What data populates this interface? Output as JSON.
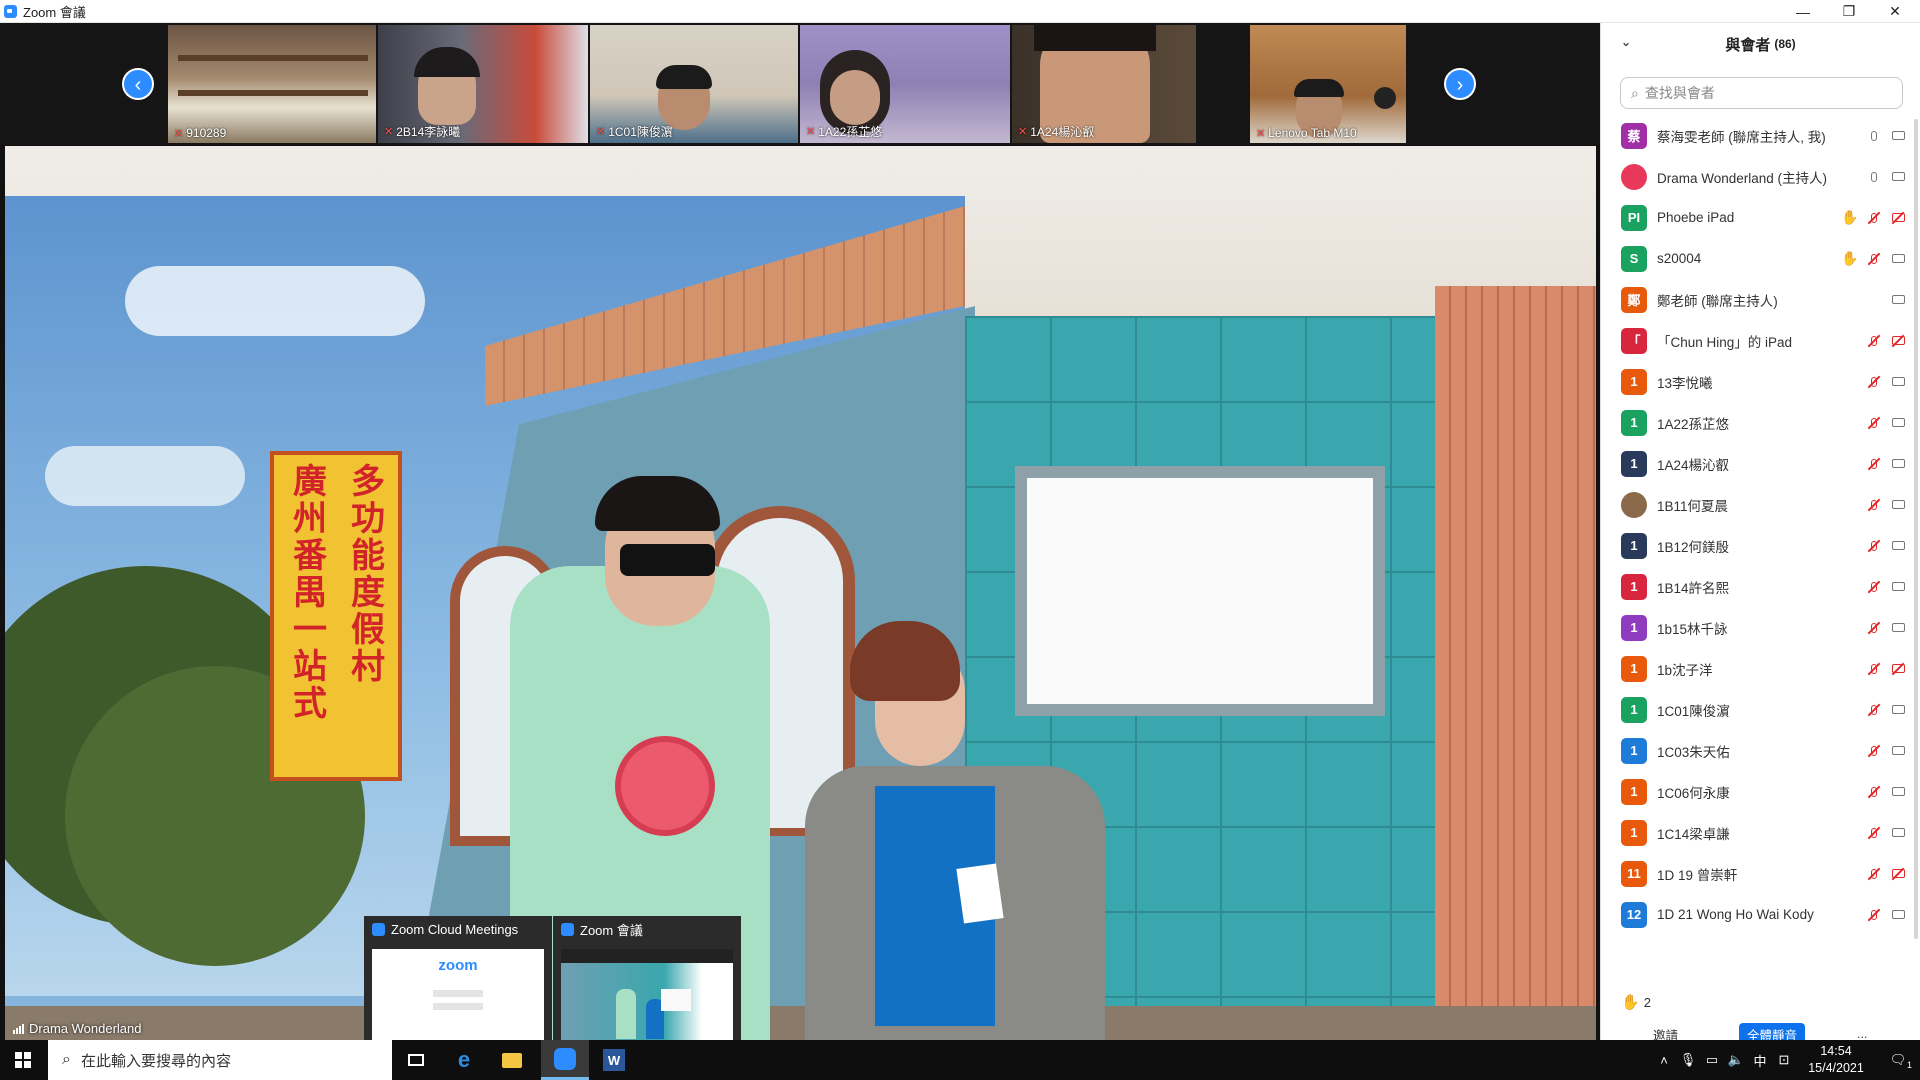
{
  "window": {
    "title": "Zoom 會議"
  },
  "thumbnails": [
    {
      "name": "910289"
    },
    {
      "name": "2B14李詠曦"
    },
    {
      "name": "1C01陳俊濵"
    },
    {
      "name": "1A22孫芷悠"
    },
    {
      "name": "1A24楊沁叡"
    },
    {
      "name": "Lenovo Tab M10"
    }
  ],
  "stage": {
    "speaker_name": "Drama Wonderland",
    "sign_left": "多功能度假村",
    "sign_right": "廣州番禺一站式"
  },
  "previews": [
    {
      "title": "Zoom Cloud Meetings",
      "logo": "zoom"
    },
    {
      "title": "Zoom 會議"
    }
  ],
  "participants_panel": {
    "title": "與會者",
    "count": "(86)",
    "search_placeholder": "查找與會者",
    "participants": [
      {
        "initial": "蔡",
        "color": "#a12fa5",
        "name": "蔡海雯老師 (聯席主持人, 我)",
        "hand": false,
        "mic": "on",
        "cam": "off"
      },
      {
        "initial": "",
        "color": "#e8395b",
        "name": "Drama Wonderland (主持人)",
        "hand": false,
        "mic": "on",
        "cam": "off",
        "photo": true
      },
      {
        "initial": "PI",
        "color": "#1aa260",
        "name": "Phoebe iPad",
        "hand": true,
        "mic": "muted",
        "cam": "muted"
      },
      {
        "initial": "S",
        "color": "#1aa260",
        "name": "s20004",
        "hand": true,
        "mic": "muted",
        "cam": "off"
      },
      {
        "initial": "鄭",
        "color": "#e8590c",
        "name": "鄭老師 (聯席主持人)",
        "hand": false,
        "mic": "none",
        "cam": "off"
      },
      {
        "initial": "「",
        "color": "#d7263d",
        "name": "「Chun Hing」的 iPad",
        "hand": false,
        "mic": "muted",
        "cam": "muted"
      },
      {
        "initial": "1",
        "color": "#e8590c",
        "name": "13李悅曦",
        "hand": false,
        "mic": "muted",
        "cam": "off"
      },
      {
        "initial": "1",
        "color": "#1aa260",
        "name": "1A22孫芷悠",
        "hand": false,
        "mic": "muted",
        "cam": "off"
      },
      {
        "initial": "1",
        "color": "#2a3a5a",
        "name": "1A24楊沁叡",
        "hand": false,
        "mic": "muted",
        "cam": "off"
      },
      {
        "initial": "",
        "color": "#8a6a4a",
        "name": "1B11何夏晨",
        "hand": false,
        "mic": "muted",
        "cam": "off",
        "photo": true
      },
      {
        "initial": "1",
        "color": "#2a3a5a",
        "name": "1B12何鎂殷",
        "hand": false,
        "mic": "muted",
        "cam": "off"
      },
      {
        "initial": "1",
        "color": "#d7263d",
        "name": "1B14許名熙",
        "hand": false,
        "mic": "muted",
        "cam": "off"
      },
      {
        "initial": "1",
        "color": "#8e3bbf",
        "name": "1b15林千詠",
        "hand": false,
        "mic": "muted",
        "cam": "off"
      },
      {
        "initial": "1",
        "color": "#e8590c",
        "name": "1b沈子洋",
        "hand": false,
        "mic": "muted",
        "cam": "muted"
      },
      {
        "initial": "1",
        "color": "#1aa260",
        "name": "1C01陳俊濵",
        "hand": false,
        "mic": "muted",
        "cam": "off"
      },
      {
        "initial": "1",
        "color": "#1e7bd7",
        "name": "1C03朱天佑",
        "hand": false,
        "mic": "muted",
        "cam": "off"
      },
      {
        "initial": "1",
        "color": "#e8590c",
        "name": "1C06何永康",
        "hand": false,
        "mic": "muted",
        "cam": "off"
      },
      {
        "initial": "1",
        "color": "#e8590c",
        "name": "1C14梁卓謙",
        "hand": false,
        "mic": "muted",
        "cam": "off"
      },
      {
        "initial": "11",
        "color": "#e8590c",
        "name": "1D 19 曾崇軒",
        "hand": false,
        "mic": "muted",
        "cam": "muted"
      },
      {
        "initial": "12",
        "color": "#1e7bd7",
        "name": "1D 21 Wong Ho Wai Kody",
        "hand": false,
        "mic": "muted",
        "cam": "off"
      }
    ],
    "raised_hands": "2",
    "footer": {
      "invite": "邀請",
      "mute_all": "全體靜音",
      "more": "..."
    }
  },
  "taskbar": {
    "search_placeholder": "在此輸入要搜尋的內容",
    "ime": "中",
    "time": "14:54",
    "date": "15/4/2021",
    "notification_count": "1"
  }
}
